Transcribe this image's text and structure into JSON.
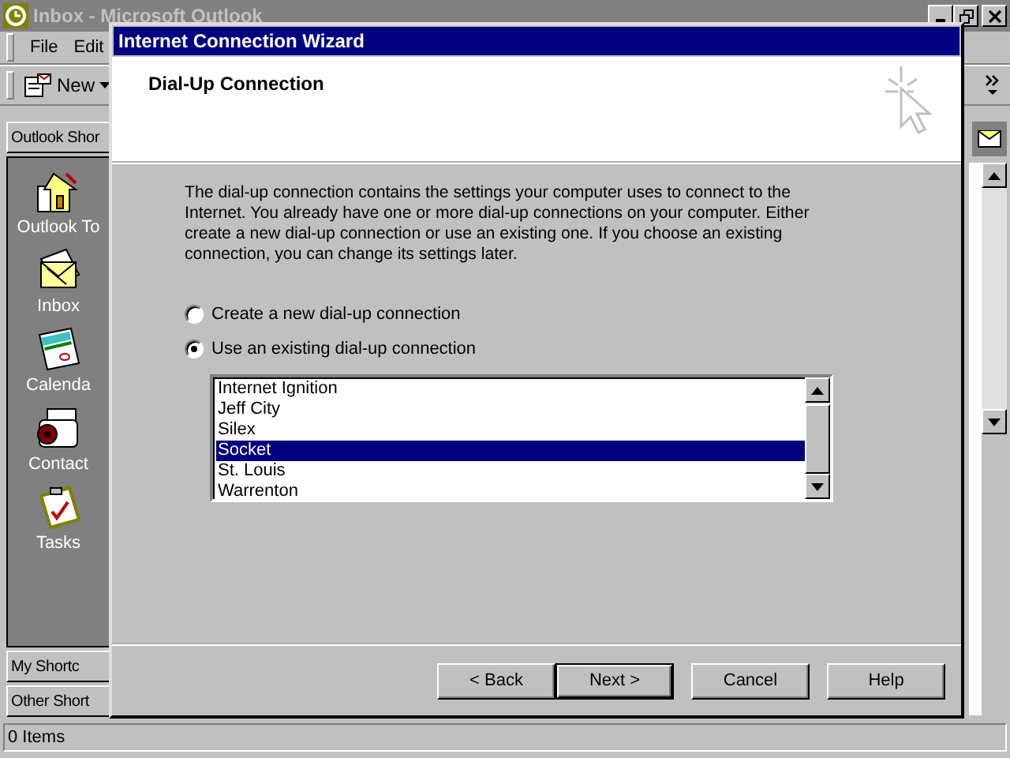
{
  "outlook_window": {
    "title": "Inbox - Microsoft Outlook",
    "menu": [
      "File",
      "Edit"
    ],
    "toolbar": {
      "new_button": "New"
    },
    "shortcuts_bar": {
      "title": "Outlook Shor",
      "items": [
        "Outlook To",
        "Inbox",
        "Calenda",
        "Contact",
        "Tasks"
      ],
      "groups": [
        "My Shortc",
        "Other Short"
      ]
    },
    "status_bar": "0 Items"
  },
  "wizard": {
    "title": "Internet Connection Wizard",
    "heading": "Dial-Up Connection",
    "description": "The dial-up connection contains the settings your computer uses to connect to the Internet. You already have one or more dial-up connections on your computer. Either create a new dial-up connection or use an existing one. If you choose an existing connection, you can change its settings later.",
    "options": [
      {
        "label": "Create a new dial-up connection",
        "selected": false
      },
      {
        "label": "Use an existing dial-up connection",
        "selected": true
      }
    ],
    "connections": [
      {
        "name": "Internet Ignition",
        "selected": false
      },
      {
        "name": "Jeff City",
        "selected": false
      },
      {
        "name": "Silex",
        "selected": false
      },
      {
        "name": "Socket",
        "selected": true
      },
      {
        "name": "St. Louis",
        "selected": false
      },
      {
        "name": "Warrenton",
        "selected": false
      }
    ],
    "buttons": [
      {
        "label": "< Back",
        "default": false
      },
      {
        "label": "Next >",
        "default": true
      },
      {
        "label": "Cancel",
        "default": false
      },
      {
        "label": "Help",
        "default": false
      }
    ]
  }
}
